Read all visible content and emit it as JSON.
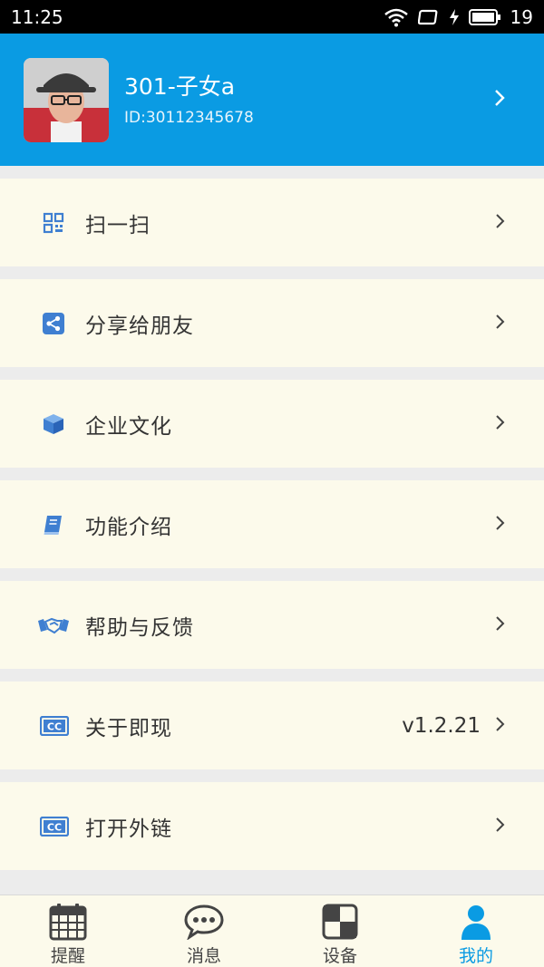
{
  "status_bar": {
    "time": "11:25",
    "battery": "19"
  },
  "profile": {
    "name": "301-子女a",
    "id": "ID:30112345678"
  },
  "menu": [
    {
      "label": "扫一扫",
      "icon": "qr-code-icon",
      "value": ""
    },
    {
      "label": "分享给朋友",
      "icon": "share-icon",
      "value": ""
    },
    {
      "label": "企业文化",
      "icon": "cube-icon",
      "value": ""
    },
    {
      "label": "功能介绍",
      "icon": "book-icon",
      "value": ""
    },
    {
      "label": "帮助与反馈",
      "icon": "handshake-icon",
      "value": ""
    },
    {
      "label": "关于即现",
      "icon": "cc-icon",
      "value": "v1.2.21"
    },
    {
      "label": "打开外链",
      "icon": "cc-icon",
      "value": ""
    }
  ],
  "tabs": [
    {
      "label": "提醒",
      "icon": "calendar-icon",
      "active": false
    },
    {
      "label": "消息",
      "icon": "chat-bubble-icon",
      "active": false
    },
    {
      "label": "设备",
      "icon": "device-grid-icon",
      "active": false
    },
    {
      "label": "我的",
      "icon": "person-icon",
      "active": true
    }
  ],
  "colors": {
    "header_blue": "#0a9be3",
    "menu_bg": "#fcfaeb",
    "icon_blue": "#3f7fd1",
    "active_tab": "#0a9be3"
  }
}
